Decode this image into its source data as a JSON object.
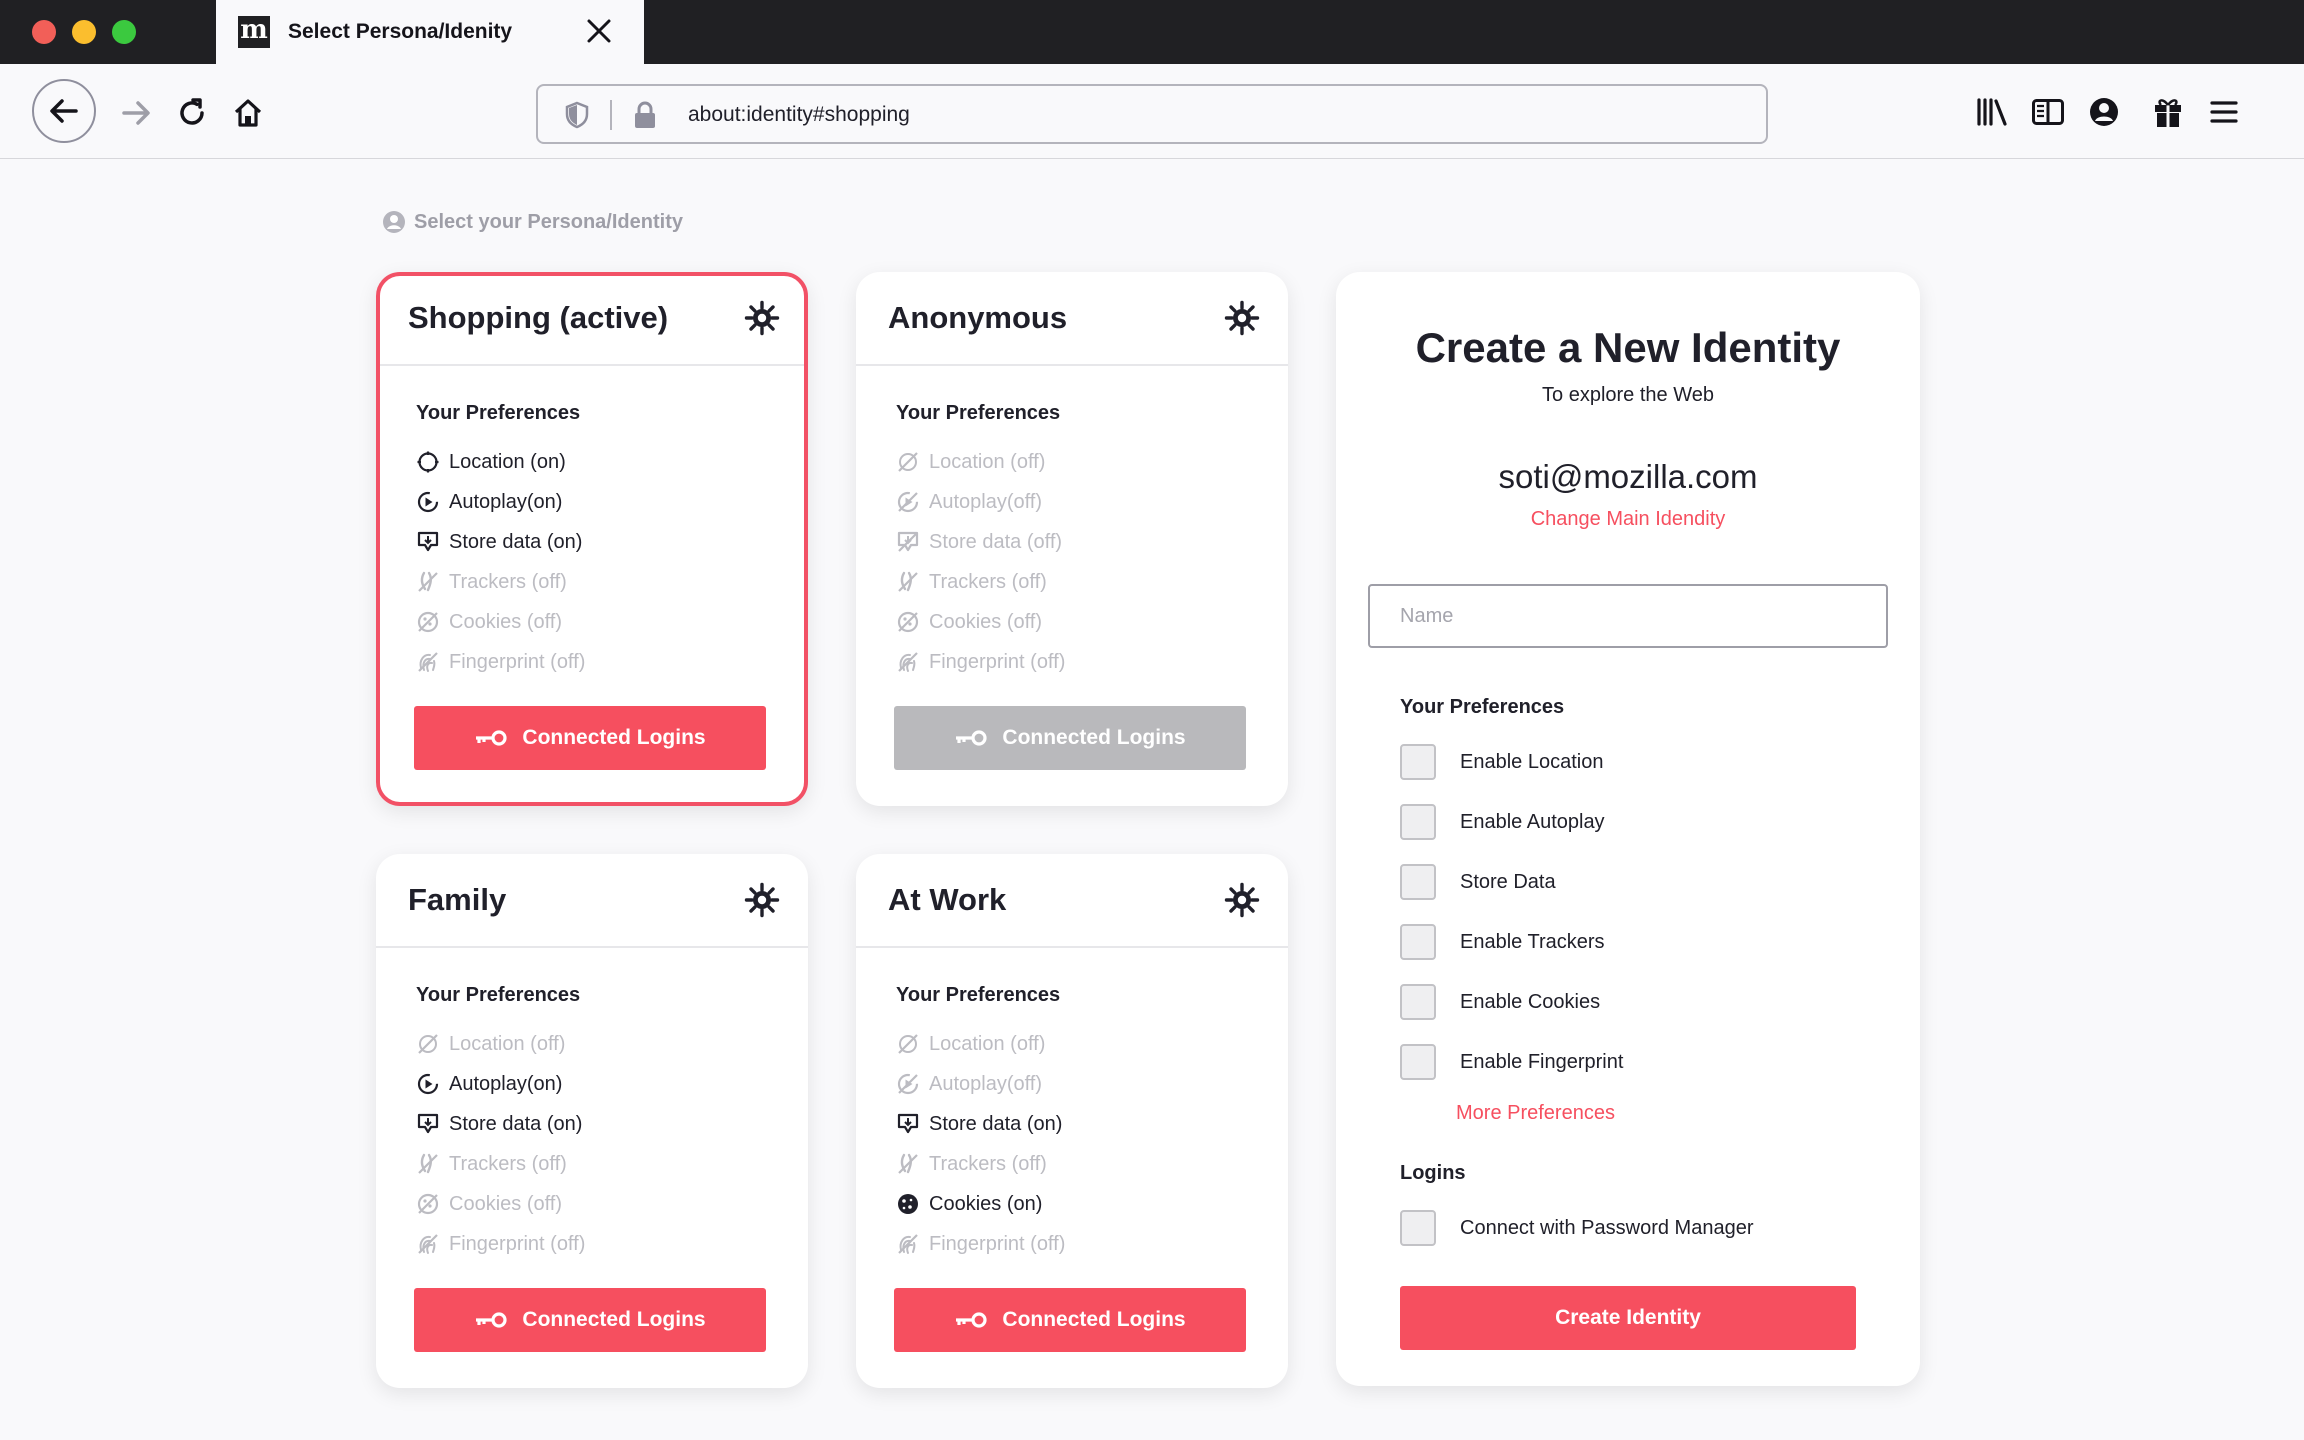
{
  "browser": {
    "tab_title": "Select Persona/Idenity",
    "tab_logo": "m",
    "url": "about:identity#shopping"
  },
  "page": {
    "label": "Select your Persona/Identity"
  },
  "cards": [
    {
      "title": "Shopping (active)",
      "active": true,
      "prefs_heading": "Your Preferences",
      "prefs": [
        {
          "label": "Location (on)",
          "on": true,
          "icon": "location-icon"
        },
        {
          "label": "Autoplay(on)",
          "on": true,
          "icon": "autoplay-icon"
        },
        {
          "label": "Store data (on)",
          "on": true,
          "icon": "store-data-icon"
        },
        {
          "label": "Trackers (off)",
          "on": false,
          "icon": "trackers-icon"
        },
        {
          "label": "Cookies (off)",
          "on": false,
          "icon": "cookies-icon"
        },
        {
          "label": "Fingerprint (off)",
          "on": false,
          "icon": "fingerprint-icon"
        }
      ],
      "button": "Connected Logins",
      "button_disabled": false
    },
    {
      "title": "Anonymous",
      "active": false,
      "prefs_heading": "Your Preferences",
      "prefs": [
        {
          "label": "Location (off)",
          "on": false,
          "icon": "location-icon"
        },
        {
          "label": "Autoplay(off)",
          "on": false,
          "icon": "autoplay-icon"
        },
        {
          "label": "Store data (off)",
          "on": false,
          "icon": "store-data-icon"
        },
        {
          "label": "Trackers (off)",
          "on": false,
          "icon": "trackers-icon"
        },
        {
          "label": "Cookies (off)",
          "on": false,
          "icon": "cookies-icon"
        },
        {
          "label": "Fingerprint (off)",
          "on": false,
          "icon": "fingerprint-icon"
        }
      ],
      "button": "Connected Logins",
      "button_disabled": true
    },
    {
      "title": "Family",
      "active": false,
      "prefs_heading": "Your Preferences",
      "prefs": [
        {
          "label": "Location (off)",
          "on": false,
          "icon": "location-icon"
        },
        {
          "label": "Autoplay(on)",
          "on": true,
          "icon": "autoplay-icon"
        },
        {
          "label": "Store data (on)",
          "on": true,
          "icon": "store-data-icon"
        },
        {
          "label": "Trackers (off)",
          "on": false,
          "icon": "trackers-icon"
        },
        {
          "label": "Cookies (off)",
          "on": false,
          "icon": "cookies-icon"
        },
        {
          "label": "Fingerprint (off)",
          "on": false,
          "icon": "fingerprint-icon"
        }
      ],
      "button": "Connected Logins",
      "button_disabled": false
    },
    {
      "title": "At Work",
      "active": false,
      "prefs_heading": "Your Preferences",
      "prefs": [
        {
          "label": "Location (off)",
          "on": false,
          "icon": "location-icon"
        },
        {
          "label": "Autoplay(off)",
          "on": false,
          "icon": "autoplay-icon"
        },
        {
          "label": "Store data (on)",
          "on": true,
          "icon": "store-data-icon"
        },
        {
          "label": "Trackers (off)",
          "on": false,
          "icon": "trackers-icon"
        },
        {
          "label": "Cookies (on)",
          "on": true,
          "icon": "cookies-icon"
        },
        {
          "label": "Fingerprint (off)",
          "on": false,
          "icon": "fingerprint-icon"
        }
      ],
      "button": "Connected Logins",
      "button_disabled": false
    }
  ],
  "create": {
    "title": "Create a New Identity",
    "subtitle": "To explore the Web",
    "email": "soti@mozilla.com",
    "change_link": "Change Main Idendity",
    "name_placeholder": "Name",
    "prefs_heading": "Your Preferences",
    "options": [
      "Enable Location",
      "Enable Autoplay",
      "Store Data",
      "Enable Trackers",
      "Enable Cookies",
      "Enable Fingerprint"
    ],
    "more_prefs": "More Preferences",
    "logins_heading": "Logins",
    "login_option": "Connect with Password Manager",
    "submit": "Create Identity"
  },
  "colors": {
    "accent": "#f64f5f",
    "active_border": "#f25166",
    "disabled_button": "#b9b9bc",
    "off_text": "#bcbcc2"
  }
}
